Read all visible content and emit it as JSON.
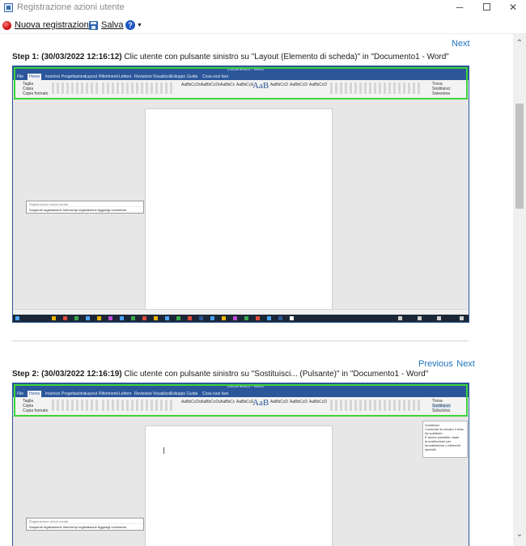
{
  "window": {
    "title": "Registrazione azioni utente",
    "minimize_glyph": "─",
    "close_glyph": "✕"
  },
  "toolbar": {
    "new_recording_label": "Nuova registrazione",
    "save_label": "Salva",
    "help_glyph": "?",
    "help_caret": "▼"
  },
  "steps": [
    {
      "nav": {
        "next": "Next"
      },
      "number": "Step 1: (30/03/2022 12:16:12)",
      "description": "Clic utente con pulsante sinistro su \"Layout (Elemento di scheda)\" in \"Documento1 - Word\""
    },
    {
      "nav": {
        "previous": "Previous",
        "next": "Next"
      },
      "number": "Step 2: (30/03/2022 12:16:19)",
      "description": "Clic utente con pulsante sinistro su \"Sostituisci... (Pulsante)\" in \"Documento1 - Word\""
    }
  ],
  "screenshot": {
    "word_title": "Documento1 - Word",
    "tabs": [
      "File",
      "Home",
      "Inserisci",
      "Progettazione",
      "Layout",
      "Riferimenti",
      "Lettere",
      "Revisione",
      "Visualizza",
      "Sviluppo",
      "Guida",
      "Cosa vuoi fare"
    ],
    "styles": [
      "AaBbCcDc",
      "AaBbCcDc",
      "AaBbCc",
      "AaBbCcE",
      "AaB",
      "AaBbCcD",
      "AaBbCcD",
      "AaBbCcD"
    ],
    "style_big": "AaB",
    "editing": [
      "Trova",
      "Sostituisci",
      "Seleziona"
    ],
    "clipboard": [
      "Taglia",
      "Copia",
      "Copia formato"
    ],
    "mini_recorder_bar": "Sospendi registrazione   Interrompi registrazione   Aggiungi commento",
    "popup_text": [
      "Sostituisci",
      "Consente di cercare il testo da sostituire.",
      "È anche possibile usare",
      "la sostituzione per",
      "formattazione o elementi",
      "speciali."
    ]
  },
  "colors": {
    "accent_link": "#1e73be",
    "word_blue": "#2b579a",
    "highlight_green": "#3bd43b",
    "record_red": "#c40000"
  }
}
